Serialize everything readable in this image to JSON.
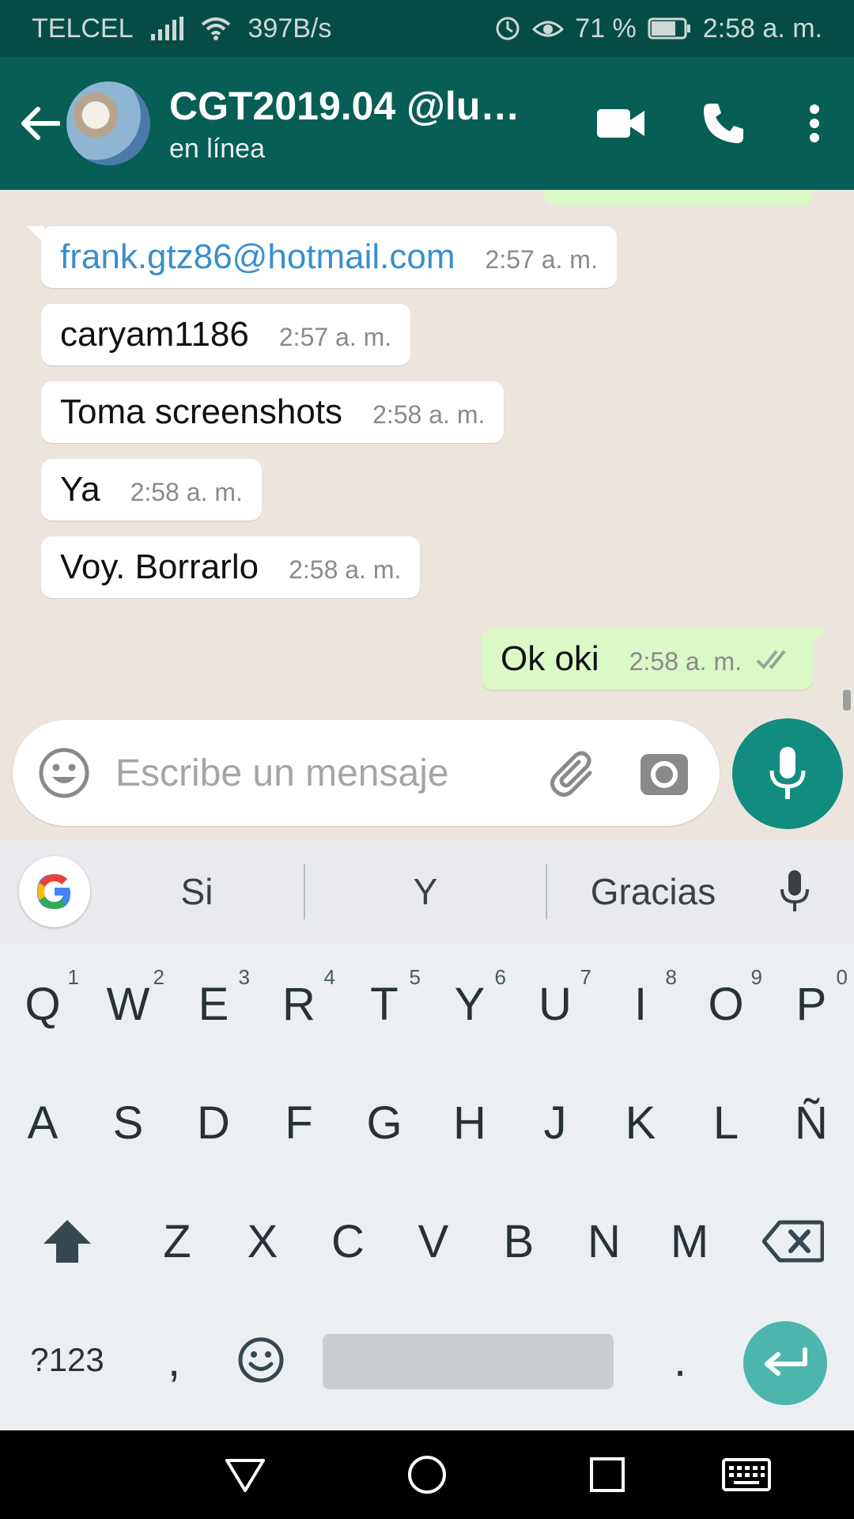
{
  "status_bar": {
    "carrier": "TELCEL",
    "net_speed": "397B/s",
    "battery_pct": "71 %",
    "time": "2:58 a. m."
  },
  "header": {
    "title": "CGT2019.04 @lu…",
    "subtitle": "en línea"
  },
  "messages": [
    {
      "text": "frank.gtz86@hotmail.com",
      "time": "2:57 a. m.",
      "direction": "in",
      "is_link": true
    },
    {
      "text": "caryam1186",
      "time": "2:57 a. m.",
      "direction": "in"
    },
    {
      "text": "Toma screenshots",
      "time": "2:58 a. m.",
      "direction": "in"
    },
    {
      "text": "Ya",
      "time": "2:58 a. m.",
      "direction": "in"
    },
    {
      "text": "Voy. Borrarlo",
      "time": "2:58 a. m.",
      "direction": "in"
    },
    {
      "text": "Ok oki",
      "time": "2:58 a. m.",
      "direction": "out",
      "status": "read"
    }
  ],
  "composer": {
    "placeholder": "Escribe un mensaje"
  },
  "suggestions": [
    "Si",
    "Y",
    "Gracias"
  ],
  "keyboard": {
    "row1": [
      {
        "key": "Q",
        "hint": "1"
      },
      {
        "key": "W",
        "hint": "2"
      },
      {
        "key": "E",
        "hint": "3"
      },
      {
        "key": "R",
        "hint": "4"
      },
      {
        "key": "T",
        "hint": "5"
      },
      {
        "key": "Y",
        "hint": "6"
      },
      {
        "key": "U",
        "hint": "7"
      },
      {
        "key": "I",
        "hint": "8"
      },
      {
        "key": "O",
        "hint": "9"
      },
      {
        "key": "P",
        "hint": "0"
      }
    ],
    "row2": [
      "A",
      "S",
      "D",
      "F",
      "G",
      "H",
      "J",
      "K",
      "L",
      "Ñ"
    ],
    "row3": [
      "Z",
      "X",
      "C",
      "V",
      "B",
      "N",
      "M"
    ],
    "symbols_label": "?123",
    "comma": ",",
    "period": "."
  },
  "colors": {
    "status_bar": "#054d44",
    "app_bar": "#075e54",
    "accent": "#128c7e",
    "outgoing_bubble": "#dcf8c6",
    "link": "#3a8fcb"
  }
}
